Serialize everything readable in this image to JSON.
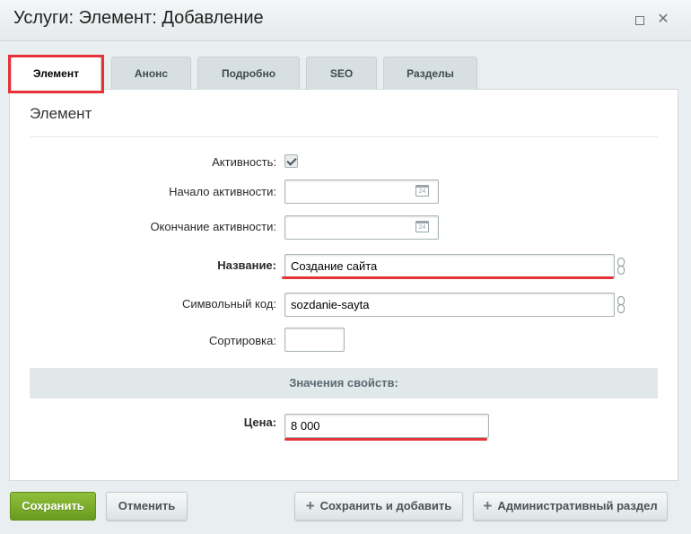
{
  "window": {
    "title": "Услуги: Элемент: Добавление",
    "maximize_icon": "maximize-icon",
    "close_icon": "close-icon",
    "close_glyph": "✕"
  },
  "tabs": [
    {
      "label": "Элемент",
      "active": true
    },
    {
      "label": "Анонс",
      "active": false
    },
    {
      "label": "Подробно",
      "active": false
    },
    {
      "label": "SEO",
      "active": false
    },
    {
      "label": "Разделы",
      "active": false
    }
  ],
  "section": {
    "title": "Элемент"
  },
  "form": {
    "active": {
      "label": "Активность:",
      "checked": true
    },
    "start": {
      "label": "Начало активности:",
      "value": ""
    },
    "end": {
      "label": "Окончание активности:",
      "value": ""
    },
    "name": {
      "label": "Название:",
      "value": "Создание сайта"
    },
    "code": {
      "label": "Символьный код:",
      "value": "sozdanie-sayta"
    },
    "sort": {
      "label": "Сортировка:",
      "value": ""
    }
  },
  "properties": {
    "header": "Значения свойств:",
    "price": {
      "label": "Цена:",
      "value": "8 000"
    }
  },
  "buttons": {
    "save": "Сохранить",
    "cancel": "Отменить",
    "save_add": "Сохранить и добавить",
    "admin": "Административный раздел",
    "plus_glyph": "+"
  },
  "colors": {
    "highlight": "#e63339",
    "save_button": "#7aaa2a"
  }
}
